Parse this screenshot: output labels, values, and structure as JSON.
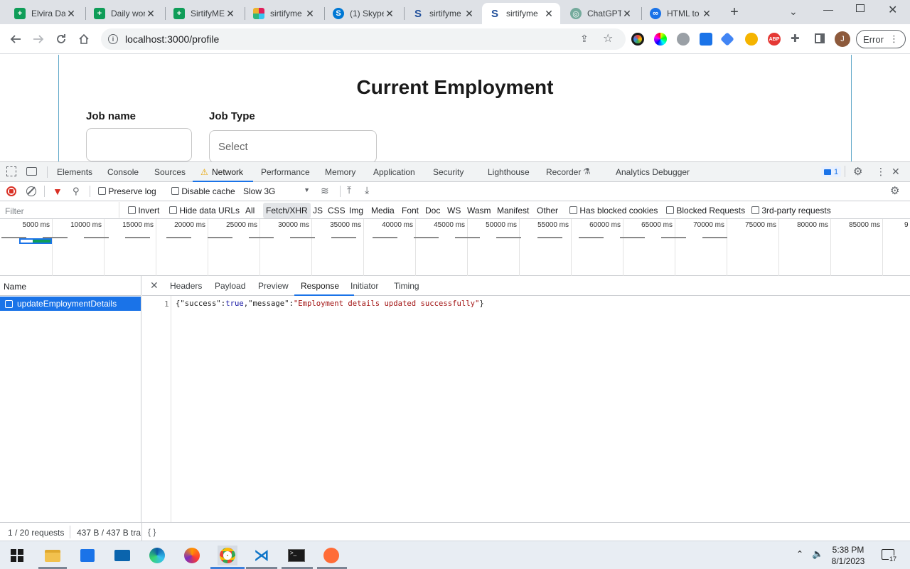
{
  "browser": {
    "tabs": [
      {
        "label": "Elvira Da",
        "favicon": "sheets-icon",
        "color": "#0f9d58"
      },
      {
        "label": "Daily wor",
        "favicon": "sheets-icon",
        "color": "#0f9d58"
      },
      {
        "label": "SirtifyME",
        "favicon": "sheets-icon",
        "color": "#0f9d58"
      },
      {
        "label": "sirtifyme",
        "favicon": "slack-icon",
        "color": "#e01e5a"
      },
      {
        "label": "(1) Skype",
        "favicon": "skype-icon",
        "color": "#0078d4"
      },
      {
        "label": "sirtifyme",
        "favicon": "sirtify-icon",
        "color": "#1f4e9a"
      },
      {
        "label": "sirtifyme",
        "favicon": "sirtify-icon",
        "color": "#1f4e9a"
      },
      {
        "label": "ChatGPT",
        "favicon": "chatgpt-icon",
        "color": "#74aa9c"
      },
      {
        "label": "HTML to",
        "favicon": "globe-icon",
        "color": "#1a73e8"
      }
    ],
    "active_tab_index": 6,
    "url": "localhost:3000/profile",
    "error_button": "Error",
    "profile_initial": "J"
  },
  "page": {
    "title": "Current Employment",
    "job_name_label": "Job name",
    "job_type_label": "Job Type",
    "job_type_placeholder": "Select"
  },
  "devtools": {
    "tabs": [
      "Elements",
      "Console",
      "Sources",
      "Network",
      "Performance",
      "Memory",
      "Application",
      "Security",
      "Lighthouse",
      "Recorder",
      "Analytics Debugger"
    ],
    "active_tab": "Network",
    "issues_count": "1",
    "toolbar": {
      "preserve_log": "Preserve log",
      "disable_cache": "Disable cache",
      "throttle": "Slow 3G"
    },
    "filter": {
      "placeholder": "Filter",
      "invert": "Invert",
      "hide_data_urls": "Hide data URLs",
      "types": [
        "All",
        "Fetch/XHR",
        "JS",
        "CSS",
        "Img",
        "Media",
        "Font",
        "Doc",
        "WS",
        "Wasm",
        "Manifest",
        "Other"
      ],
      "active_type": "Fetch/XHR",
      "has_blocked_cookies": "Has blocked cookies",
      "blocked_requests": "Blocked Requests",
      "third_party": "3rd-party requests"
    },
    "timeline_ticks": [
      "5000 ms",
      "10000 ms",
      "15000 ms",
      "20000 ms",
      "25000 ms",
      "30000 ms",
      "35000 ms",
      "40000 ms",
      "45000 ms",
      "50000 ms",
      "55000 ms",
      "60000 ms",
      "65000 ms",
      "70000 ms",
      "75000 ms",
      "80000 ms",
      "85000 ms",
      "9"
    ],
    "name_header": "Name",
    "request_name": "updateEmploymentDetails",
    "detail_tabs": [
      "Headers",
      "Payload",
      "Preview",
      "Response",
      "Initiator",
      "Timing"
    ],
    "active_detail_tab": "Response",
    "response": {
      "line_number": "1",
      "k_success": "\"success\"",
      "v_success": "true",
      "k_message": "\"message\"",
      "v_message": "\"Employment details updated successfully\""
    },
    "status": {
      "requests": "1 / 20 requests",
      "transferred": "437 B / 437 B tra",
      "format": "{ }"
    }
  },
  "taskbar": {
    "time": "5:38 PM",
    "date": "8/1/2023",
    "notifications": "17"
  }
}
